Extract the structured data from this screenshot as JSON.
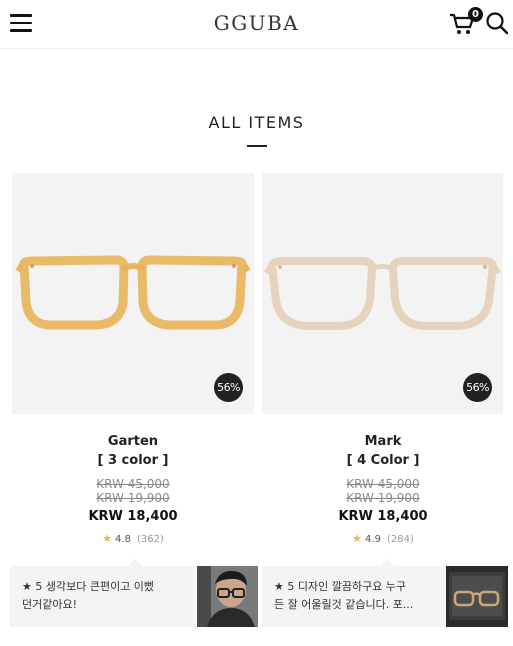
{
  "header": {
    "logo": "GGUBA",
    "cart_count": "0",
    "menu_icon": "hamburger-icon",
    "cart_icon": "cart-icon",
    "search_icon": "search-icon"
  },
  "section": {
    "title": "ALL ITEMS"
  },
  "products": [
    {
      "name": "Garten",
      "colors": "[ 3 color ]",
      "original_price_1": "KRW 45,000",
      "original_price_2": "KRW 19,900",
      "sale_price": "KRW 18,400",
      "discount": "56%",
      "rating": "4.8",
      "review_count": "(362)",
      "frame_color": "#e8b55a"
    },
    {
      "name": "Mark",
      "colors": "[ 4 Color ]",
      "original_price_1": "KRW 45,000",
      "original_price_2": "KRW 19,900",
      "sale_price": "KRW 18,400",
      "discount": "56%",
      "rating": "4.9",
      "review_count": "(284)",
      "frame_color": "#e6d3bd"
    }
  ],
  "reviews": [
    {
      "star": "★ 5",
      "line1": "생각보다 큰편이고 이뻤",
      "line2": "던거같아요!"
    },
    {
      "star": "★ 5",
      "line1": "디자인 깔끔하구요 누구",
      "line2": "든 잘 어울릴것 같습니다. 포..."
    }
  ],
  "colors": {
    "badge_bg": "#222222",
    "star": "#e8b94a",
    "card_bg": "#f3f3f3"
  }
}
